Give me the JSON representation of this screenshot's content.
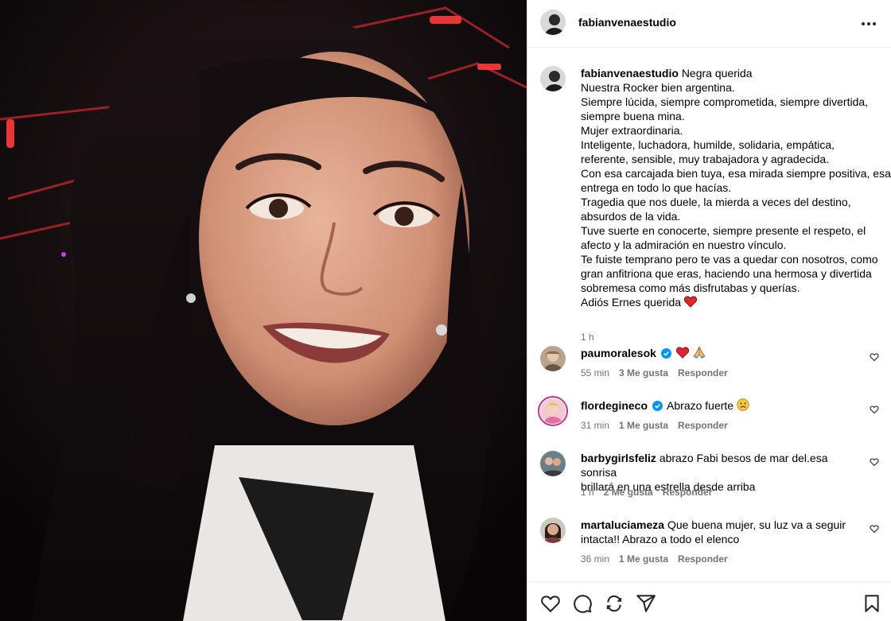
{
  "post": {
    "author": "fabianvenaestudio",
    "more_icon": "more-horizontal-icon",
    "caption_lines": [
      "Negra querida",
      "Nuestra Rocker bien argentina.",
      "Siempre lúcida, siempre comprometida, siempre divertida,",
      "siempre buena mina.",
      "Mujer extraordinaria.",
      "Inteligente, luchadora, humilde, solidaria, empática,",
      "referente, sensible, muy trabajadora y agradecida.",
      "Con esa carcajada bien tuya, esa mirada siempre positiva, esa",
      "entrega en todo lo que hacías.",
      "Tragedia que nos duele, la mierda a veces del destino,",
      "absurdos de la vida.",
      "Tuve suerte en conocerte, siempre presente el respeto, el",
      "afecto y la admiración en nuestro vínculo.",
      "Te fuiste temprano pero te vas a quedar con nosotros, como",
      "gran anfitriona que eras, haciendo una hermosa y divertida",
      "sobremesa como más disfrutabas y querías.",
      "Adiós Ernes querida"
    ],
    "caption_time": "1 h"
  },
  "comments": [
    {
      "user": "paumoralesok",
      "verified": true,
      "text_lines": [
        ""
      ],
      "emoji": [
        "red-heart-emoji",
        "folded-hands-emoji"
      ],
      "time": "55 min",
      "likes": "3 Me gusta",
      "reply": "Responder"
    },
    {
      "user": "flordegineco",
      "verified": true,
      "text_lines": [
        "Abrazo fuerte"
      ],
      "emoji": [
        "sad-face-emoji"
      ],
      "time": "31 min",
      "likes": "1 Me gusta",
      "reply": "Responder"
    },
    {
      "user": "barbygirlsfeliz",
      "verified": false,
      "text_lines": [
        "abrazo Fabi besos de mar del.esa sonrisa",
        "brillará en una estrella desde arriba"
      ],
      "time": "1 h",
      "likes": "2 Me gusta",
      "reply": "Responder"
    },
    {
      "user": "martaluciameza",
      "verified": false,
      "text_lines": [
        "Que buena mujer, su luz va a seguir",
        "intacta!! Abrazo a todo el elenco"
      ],
      "time": "36 min",
      "likes": "1 Me gusta",
      "reply": "Responder"
    }
  ],
  "actions": {
    "icons": [
      "like-icon",
      "comment-icon",
      "repost-icon",
      "share-icon",
      "save-icon"
    ]
  },
  "colors": {
    "verified": "#0095f6",
    "heart": "#ed1c24",
    "muted": "#737373",
    "border": "#dbdbdb"
  }
}
